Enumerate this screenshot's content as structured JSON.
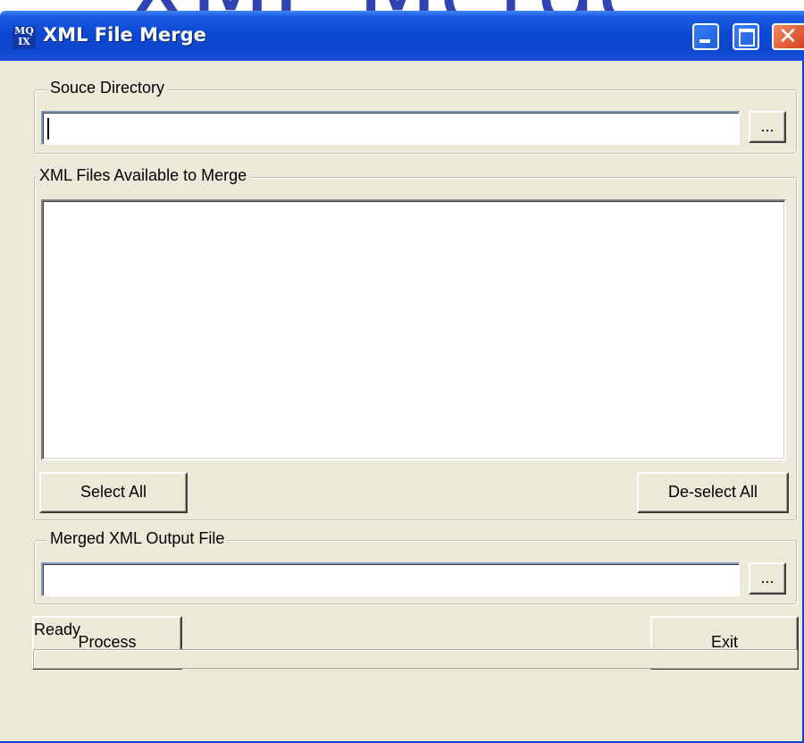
{
  "background_title": "XML Merge",
  "window": {
    "title": "XML File Merge",
    "icon_text": [
      "MQ",
      "IX"
    ],
    "controls": {
      "minimize_icon": "minimize-icon",
      "maximize_icon": "maximize-icon",
      "close_icon": "close-icon",
      "close_glyph": "✕"
    },
    "titlebar_color": "#0c46cc"
  },
  "source": {
    "group_label": "Souce Directory",
    "path_value": "",
    "browse_label": "..."
  },
  "files": {
    "group_label": "XML Files Available to Merge",
    "items": [],
    "select_all_label": "Select All",
    "deselect_all_label": "De-select All"
  },
  "output": {
    "group_label": "Merged XML Output File",
    "path_value": "",
    "browse_label": "..."
  },
  "actions": {
    "process_label": "Process",
    "exit_label": "Exit"
  },
  "status": {
    "text": "Ready",
    "progress": 0
  }
}
